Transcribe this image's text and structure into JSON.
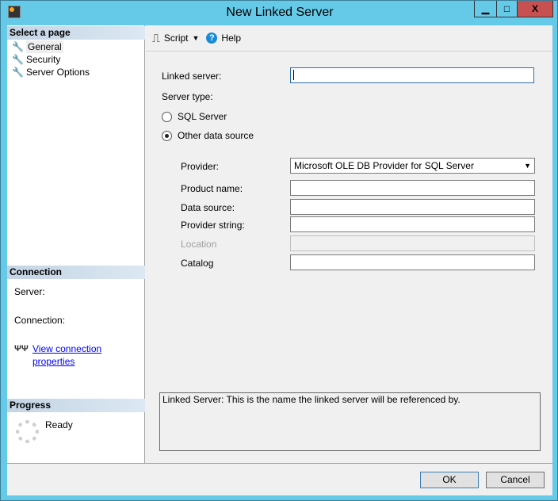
{
  "window": {
    "title": "New Linked Server",
    "minimize": "▁",
    "maximize": "□",
    "close": "X"
  },
  "sidebar": {
    "select_header": "Select a page",
    "items": [
      {
        "label": "General"
      },
      {
        "label": "Security"
      },
      {
        "label": "Server Options"
      }
    ],
    "connection_header": "Connection",
    "server_label": "Server:",
    "connection_label": "Connection:",
    "view_link": "View connection properties",
    "progress_header": "Progress",
    "progress_status": "Ready"
  },
  "toolbar": {
    "script": "Script",
    "help": "Help"
  },
  "form": {
    "linked_server_label": "Linked server:",
    "linked_server_value": "",
    "server_type_label": "Server type:",
    "radio_sql": "SQL Server",
    "radio_other": "Other data source",
    "selected": "Other data source",
    "provider_label": "Provider:",
    "provider_value": "Microsoft OLE DB Provider for SQL Server",
    "product_label": "Product name:",
    "datasource_label": "Data source:",
    "provstring_label": "Provider string:",
    "location_label": "Location",
    "catalog_label": "Catalog"
  },
  "description": "Linked Server: This is the name the linked server will be referenced by.",
  "buttons": {
    "ok": "OK",
    "cancel": "Cancel"
  }
}
